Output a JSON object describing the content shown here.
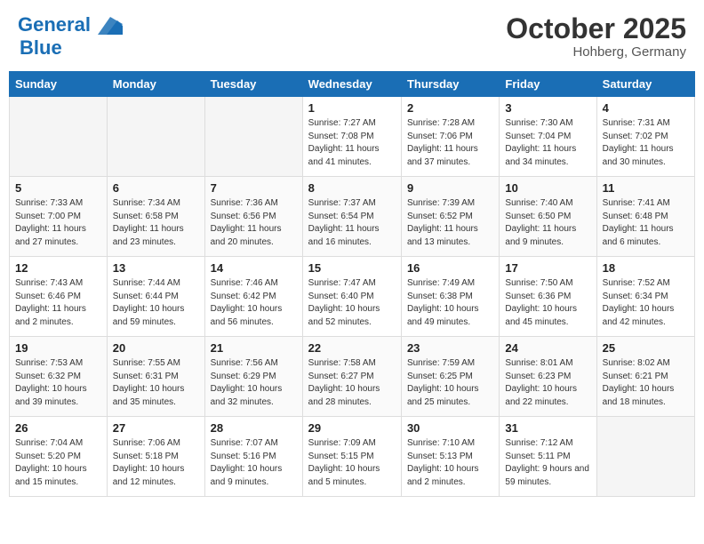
{
  "header": {
    "logo_line1": "General",
    "logo_line2": "Blue",
    "month": "October 2025",
    "location": "Hohberg, Germany"
  },
  "weekdays": [
    "Sunday",
    "Monday",
    "Tuesday",
    "Wednesday",
    "Thursday",
    "Friday",
    "Saturday"
  ],
  "weeks": [
    [
      {
        "day": "",
        "info": ""
      },
      {
        "day": "",
        "info": ""
      },
      {
        "day": "",
        "info": ""
      },
      {
        "day": "1",
        "info": "Sunrise: 7:27 AM\nSunset: 7:08 PM\nDaylight: 11 hours and 41 minutes."
      },
      {
        "day": "2",
        "info": "Sunrise: 7:28 AM\nSunset: 7:06 PM\nDaylight: 11 hours and 37 minutes."
      },
      {
        "day": "3",
        "info": "Sunrise: 7:30 AM\nSunset: 7:04 PM\nDaylight: 11 hours and 34 minutes."
      },
      {
        "day": "4",
        "info": "Sunrise: 7:31 AM\nSunset: 7:02 PM\nDaylight: 11 hours and 30 minutes."
      }
    ],
    [
      {
        "day": "5",
        "info": "Sunrise: 7:33 AM\nSunset: 7:00 PM\nDaylight: 11 hours and 27 minutes."
      },
      {
        "day": "6",
        "info": "Sunrise: 7:34 AM\nSunset: 6:58 PM\nDaylight: 11 hours and 23 minutes."
      },
      {
        "day": "7",
        "info": "Sunrise: 7:36 AM\nSunset: 6:56 PM\nDaylight: 11 hours and 20 minutes."
      },
      {
        "day": "8",
        "info": "Sunrise: 7:37 AM\nSunset: 6:54 PM\nDaylight: 11 hours and 16 minutes."
      },
      {
        "day": "9",
        "info": "Sunrise: 7:39 AM\nSunset: 6:52 PM\nDaylight: 11 hours and 13 minutes."
      },
      {
        "day": "10",
        "info": "Sunrise: 7:40 AM\nSunset: 6:50 PM\nDaylight: 11 hours and 9 minutes."
      },
      {
        "day": "11",
        "info": "Sunrise: 7:41 AM\nSunset: 6:48 PM\nDaylight: 11 hours and 6 minutes."
      }
    ],
    [
      {
        "day": "12",
        "info": "Sunrise: 7:43 AM\nSunset: 6:46 PM\nDaylight: 11 hours and 2 minutes."
      },
      {
        "day": "13",
        "info": "Sunrise: 7:44 AM\nSunset: 6:44 PM\nDaylight: 10 hours and 59 minutes."
      },
      {
        "day": "14",
        "info": "Sunrise: 7:46 AM\nSunset: 6:42 PM\nDaylight: 10 hours and 56 minutes."
      },
      {
        "day": "15",
        "info": "Sunrise: 7:47 AM\nSunset: 6:40 PM\nDaylight: 10 hours and 52 minutes."
      },
      {
        "day": "16",
        "info": "Sunrise: 7:49 AM\nSunset: 6:38 PM\nDaylight: 10 hours and 49 minutes."
      },
      {
        "day": "17",
        "info": "Sunrise: 7:50 AM\nSunset: 6:36 PM\nDaylight: 10 hours and 45 minutes."
      },
      {
        "day": "18",
        "info": "Sunrise: 7:52 AM\nSunset: 6:34 PM\nDaylight: 10 hours and 42 minutes."
      }
    ],
    [
      {
        "day": "19",
        "info": "Sunrise: 7:53 AM\nSunset: 6:32 PM\nDaylight: 10 hours and 39 minutes."
      },
      {
        "day": "20",
        "info": "Sunrise: 7:55 AM\nSunset: 6:31 PM\nDaylight: 10 hours and 35 minutes."
      },
      {
        "day": "21",
        "info": "Sunrise: 7:56 AM\nSunset: 6:29 PM\nDaylight: 10 hours and 32 minutes."
      },
      {
        "day": "22",
        "info": "Sunrise: 7:58 AM\nSunset: 6:27 PM\nDaylight: 10 hours and 28 minutes."
      },
      {
        "day": "23",
        "info": "Sunrise: 7:59 AM\nSunset: 6:25 PM\nDaylight: 10 hours and 25 minutes."
      },
      {
        "day": "24",
        "info": "Sunrise: 8:01 AM\nSunset: 6:23 PM\nDaylight: 10 hours and 22 minutes."
      },
      {
        "day": "25",
        "info": "Sunrise: 8:02 AM\nSunset: 6:21 PM\nDaylight: 10 hours and 18 minutes."
      }
    ],
    [
      {
        "day": "26",
        "info": "Sunrise: 7:04 AM\nSunset: 5:20 PM\nDaylight: 10 hours and 15 minutes."
      },
      {
        "day": "27",
        "info": "Sunrise: 7:06 AM\nSunset: 5:18 PM\nDaylight: 10 hours and 12 minutes."
      },
      {
        "day": "28",
        "info": "Sunrise: 7:07 AM\nSunset: 5:16 PM\nDaylight: 10 hours and 9 minutes."
      },
      {
        "day": "29",
        "info": "Sunrise: 7:09 AM\nSunset: 5:15 PM\nDaylight: 10 hours and 5 minutes."
      },
      {
        "day": "30",
        "info": "Sunrise: 7:10 AM\nSunset: 5:13 PM\nDaylight: 10 hours and 2 minutes."
      },
      {
        "day": "31",
        "info": "Sunrise: 7:12 AM\nSunset: 5:11 PM\nDaylight: 9 hours and 59 minutes."
      },
      {
        "day": "",
        "info": ""
      }
    ]
  ]
}
